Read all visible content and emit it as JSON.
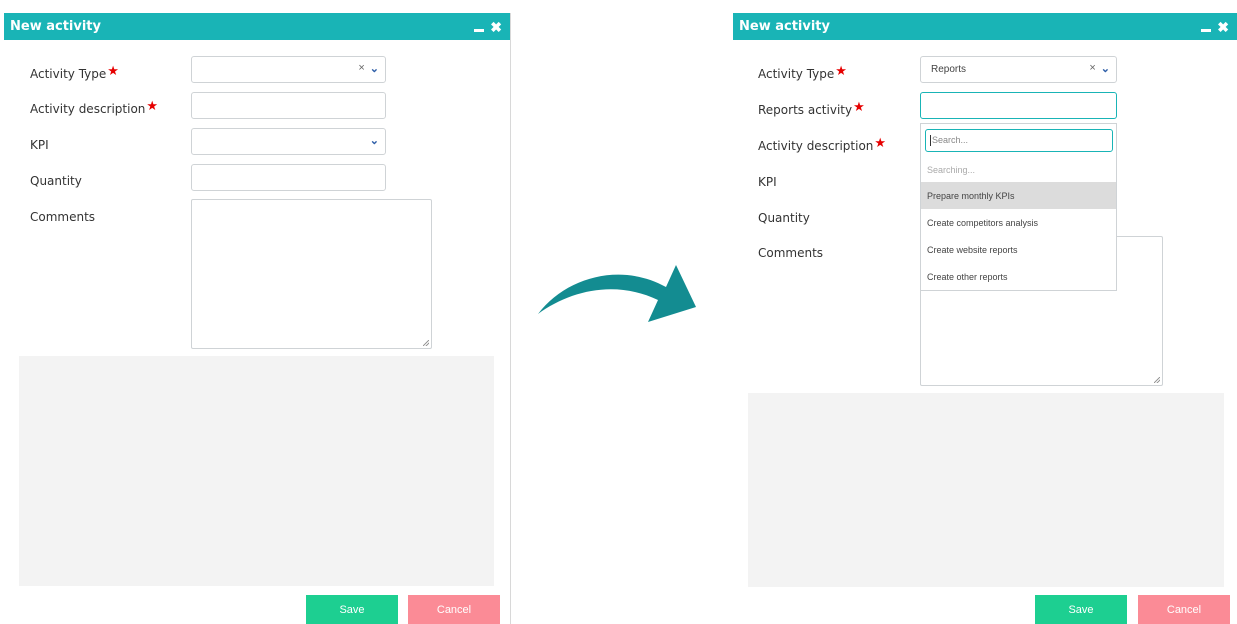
{
  "left": {
    "title": "New activity",
    "labels": {
      "activity_type": "Activity Type",
      "activity_description": "Activity description",
      "kpi": "KPI",
      "quantity": "Quantity",
      "comments": "Comments"
    },
    "required_mark": "★",
    "buttons": {
      "save": "Save",
      "cancel": "Cancel"
    }
  },
  "right": {
    "title": "New activity",
    "labels": {
      "activity_type": "Activity Type",
      "reports_activity": "Reports activity",
      "activity_description": "Activity description",
      "kpi": "KPI",
      "quantity": "Quantity",
      "comments": "Comments"
    },
    "activity_type_value": "Reports",
    "required_mark": "★",
    "dropdown": {
      "search_placeholder": "Search...",
      "status": "Searching...",
      "options": [
        "Prepare monthly KPIs",
        "Create competitors analysis",
        "Create website reports",
        "Create other reports"
      ],
      "highlighted_index": 0
    },
    "buttons": {
      "save": "Save",
      "cancel": "Cancel"
    }
  },
  "window_controls": {
    "minimize_icon": "minimize-icon",
    "close_icon": "close-icon"
  },
  "colors": {
    "titlebar": "#19b4b6",
    "save": "#1dcf91",
    "cancel": "#fb8b96",
    "required": "#e60000",
    "arrow": "#138c91"
  }
}
